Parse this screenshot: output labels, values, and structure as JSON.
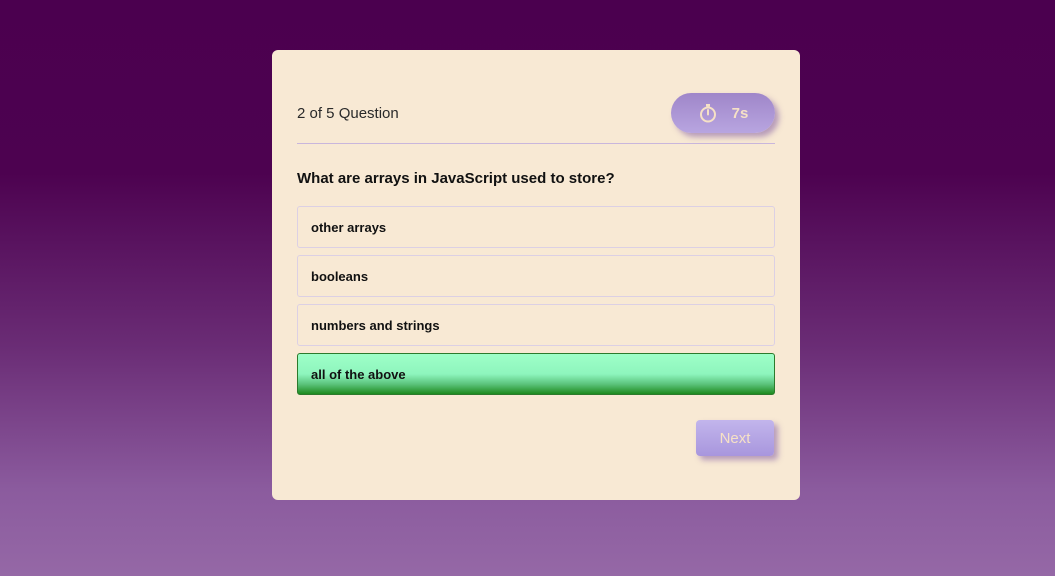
{
  "quiz": {
    "progress_text": "2 of 5 Question",
    "timer": {
      "icon": "stopwatch-icon",
      "text": "7s"
    },
    "question": "What are arrays in JavaScript used to store?",
    "options": [
      {
        "label": "other arrays",
        "state": "default"
      },
      {
        "label": "booleans",
        "state": "default"
      },
      {
        "label": "numbers and strings",
        "state": "default"
      },
      {
        "label": "all of the above",
        "state": "correct"
      }
    ],
    "next_label": "Next"
  },
  "colors": {
    "background_top": "#4b004f",
    "background_bottom": "#9568a6",
    "card": "#f8e9d4",
    "accent": "#a896dd",
    "correct": "#8ef5bd",
    "correct_dark": "#1e8a1e"
  }
}
